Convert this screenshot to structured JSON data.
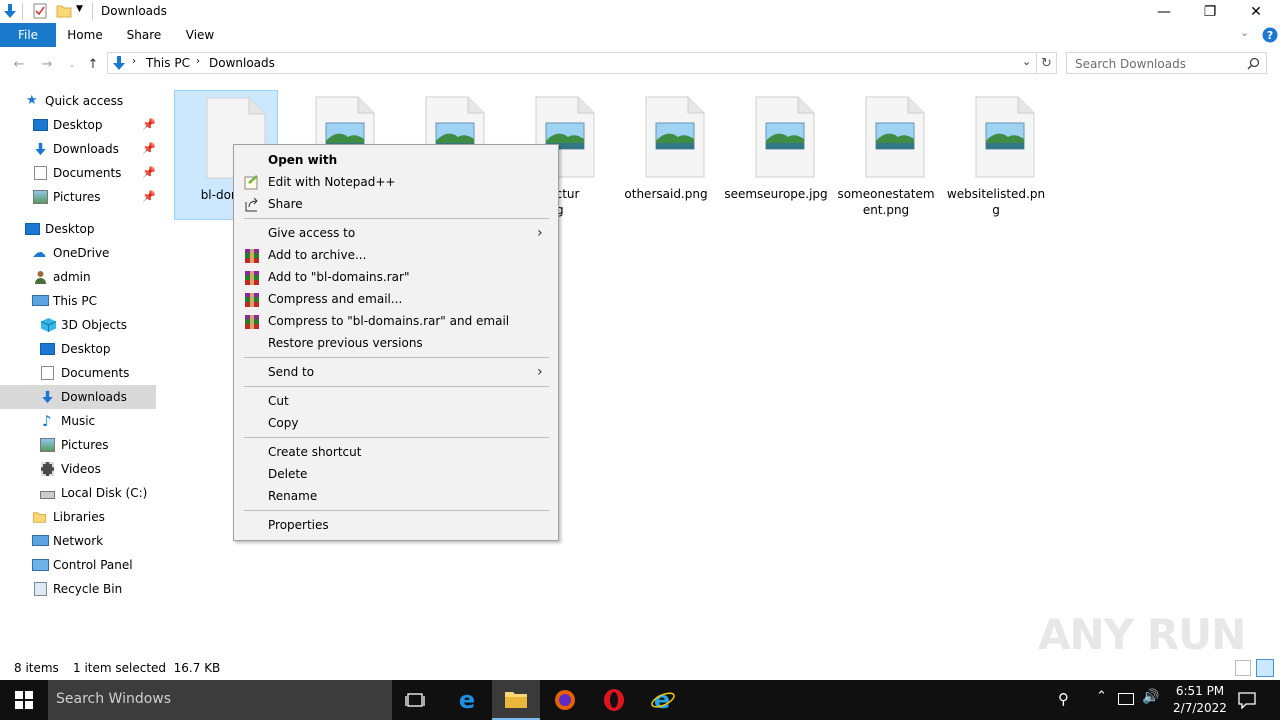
{
  "window": {
    "title": "Downloads",
    "colors": {
      "accent": "#1979ca",
      "selection": "#cce8ff",
      "sidebar_selected": "#d9d9d9"
    }
  },
  "ribbon": {
    "tabs": [
      "File",
      "Home",
      "Share",
      "View"
    ]
  },
  "address": {
    "crumbs": [
      "This PC",
      "Downloads"
    ],
    "search_placeholder": "Search Downloads"
  },
  "sidebar": {
    "items": [
      {
        "label": "Quick access",
        "icon": "star-icon"
      },
      {
        "label": "Desktop",
        "icon": "desktop-icon",
        "pinned": true
      },
      {
        "label": "Downloads",
        "icon": "download-arrow-icon",
        "pinned": true
      },
      {
        "label": "Documents",
        "icon": "documents-icon",
        "pinned": true
      },
      {
        "label": "Pictures",
        "icon": "pictures-icon",
        "pinned": true
      },
      {
        "label": "Desktop",
        "icon": "desktop-icon"
      },
      {
        "label": "OneDrive",
        "icon": "cloud-icon"
      },
      {
        "label": "admin",
        "icon": "user-icon"
      },
      {
        "label": "This PC",
        "icon": "computer-icon"
      },
      {
        "label": "3D Objects",
        "icon": "cube-icon"
      },
      {
        "label": "Desktop",
        "icon": "desktop-icon"
      },
      {
        "label": "Documents",
        "icon": "documents-icon"
      },
      {
        "label": "Downloads",
        "icon": "download-arrow-icon",
        "selected": true
      },
      {
        "label": "Music",
        "icon": "music-note-icon"
      },
      {
        "label": "Pictures",
        "icon": "pictures-icon"
      },
      {
        "label": "Videos",
        "icon": "film-icon"
      },
      {
        "label": "Local Disk (C:)",
        "icon": "disk-icon"
      },
      {
        "label": "Libraries",
        "icon": "folder-icon"
      },
      {
        "label": "Network",
        "icon": "network-icon"
      },
      {
        "label": "Control Panel",
        "icon": "control-panel-icon"
      },
      {
        "label": "Recycle Bin",
        "icon": "recycle-bin-icon"
      }
    ]
  },
  "files": [
    {
      "name": "bl-domai",
      "type": "blank",
      "selected": true
    },
    {
      "name": "",
      "type": "image"
    },
    {
      "name": "",
      "type": "image"
    },
    {
      "name": "hitectur\npg",
      "type": "image"
    },
    {
      "name": "othersaid.png",
      "type": "image"
    },
    {
      "name": "seemseurope.jpg",
      "type": "image"
    },
    {
      "name": "someonestatement.png",
      "type": "image"
    },
    {
      "name": "websitelisted.png",
      "type": "image"
    }
  ],
  "context_menu": {
    "items": [
      {
        "label": "Open with",
        "bold": true
      },
      {
        "label": "Edit with Notepad++",
        "icon": "notepad-plus-icon"
      },
      {
        "label": "Share",
        "icon": "share-icon"
      },
      {
        "label": "Give access to",
        "submenu": true
      },
      {
        "label": "Add to archive...",
        "icon": "winrar-icon"
      },
      {
        "label": "Add to \"bl-domains.rar\"",
        "icon": "winrar-icon"
      },
      {
        "label": "Compress and email...",
        "icon": "winrar-icon"
      },
      {
        "label": "Compress to \"bl-domains.rar\" and email",
        "icon": "winrar-icon"
      },
      {
        "label": "Restore previous versions"
      },
      {
        "label": "Send to",
        "submenu": true
      },
      {
        "label": "Cut"
      },
      {
        "label": "Copy"
      },
      {
        "label": "Create shortcut"
      },
      {
        "label": "Delete"
      },
      {
        "label": "Rename"
      },
      {
        "label": "Properties"
      }
    ]
  },
  "status": {
    "count": "8 items",
    "selection": "1 item selected  16.7 KB"
  },
  "taskbar": {
    "search": "Search Windows",
    "time": "6:51 PM",
    "date": "2/7/2022",
    "apps": [
      "task-view-icon",
      "edge-icon",
      "file-explorer-icon",
      "firefox-icon",
      "opera-icon",
      "internet-explorer-icon"
    ]
  },
  "watermark": "ANY RUN"
}
